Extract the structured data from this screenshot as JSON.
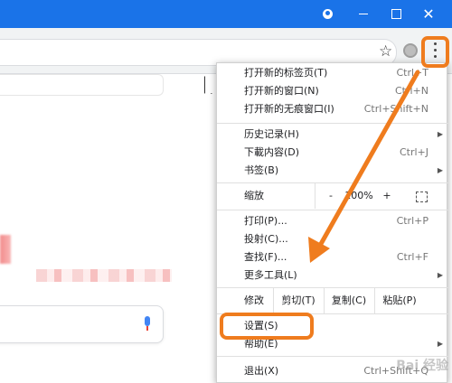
{
  "titlebar": {
    "account_icon": "account-icon",
    "minimize_icon": "minimize-icon",
    "maximize_icon": "maximize-icon",
    "close_glyph": "✕",
    "color": "#1a73e8"
  },
  "toolbar": {
    "star_glyph": "☆",
    "extension_icon": "extension-icon",
    "menu_icon": "kebab-menu-icon"
  },
  "menu": {
    "items_top": [
      {
        "label": "打开新的标签页(T)",
        "shortcut": "Ctrl+T"
      },
      {
        "label": "打开新的窗口(N)",
        "shortcut": "Ctrl+N"
      },
      {
        "label": "打开新的无痕窗口(I)",
        "shortcut": "Ctrl+Shift+N"
      }
    ],
    "items_history": [
      {
        "label": "历史记录(H)",
        "shortcut": "",
        "arrow": "▶"
      },
      {
        "label": "下載内容(D)",
        "shortcut": "Ctrl+J",
        "arrow": ""
      },
      {
        "label": "书签(B)",
        "shortcut": "",
        "arrow": "▶"
      }
    ],
    "zoom": {
      "label": "缩放",
      "minus": "-",
      "value": "100%",
      "plus": "+",
      "fullscreen_icon": "fullscreen-icon"
    },
    "items_tools": [
      {
        "label": "打印(P)...",
        "shortcut": "Ctrl+P",
        "arrow": ""
      },
      {
        "label": "投射(C)...",
        "shortcut": "",
        "arrow": ""
      },
      {
        "label": "查找(F)...",
        "shortcut": "Ctrl+F",
        "arrow": ""
      },
      {
        "label": "更多工具(L)",
        "shortcut": "",
        "arrow": "▶"
      }
    ],
    "edit": {
      "label": "修改",
      "cut": "剪切(T)",
      "copy": "复制(C)",
      "paste": "粘贴(P)"
    },
    "items_settings": [
      {
        "label": "设置(S)",
        "shortcut": "",
        "arrow": ""
      },
      {
        "label": "帮助(E)",
        "shortcut": "",
        "arrow": "▶"
      }
    ],
    "exit": {
      "label": "退出(X)",
      "shortcut": "Ctrl+Shift+Q"
    }
  },
  "annotations": {
    "highlight_color": "#ef7c1e"
  },
  "watermark": "Bai 经验"
}
